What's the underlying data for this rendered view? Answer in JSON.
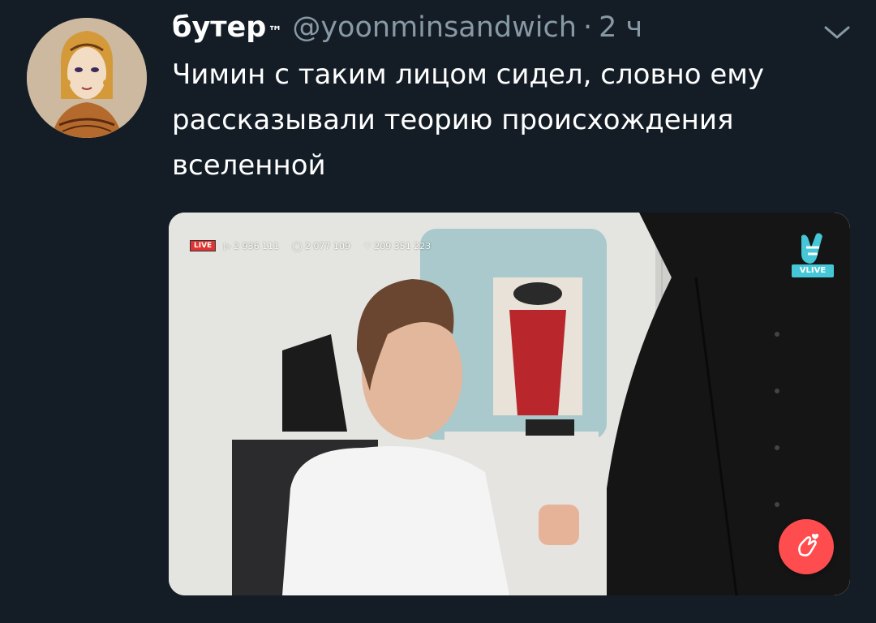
{
  "tweet": {
    "display_name": "бутер",
    "name_mark": "™",
    "handle": "@yoonminsandwich",
    "separator": "·",
    "time": "2 ч",
    "text": "Чимин с таким лицом сидел, словно ему\nрассказывали теорию происхождения\nвселенной"
  },
  "media": {
    "live_label": "LIVE",
    "views": "▷ 2 936 111",
    "comments": "◯ 2 077 109",
    "hearts": "♡ 209 351 223",
    "vlive_label": "VLIVE"
  },
  "icons": {
    "menu": "chevron-down-icon",
    "vlive": "vlive-logo-icon",
    "reaction": "finger-heart-icon"
  },
  "colors": {
    "background": "#141d26",
    "secondary_text": "#8899a6",
    "vlive_accent": "#45c7d8",
    "reaction_button": "#ff4d4f"
  }
}
